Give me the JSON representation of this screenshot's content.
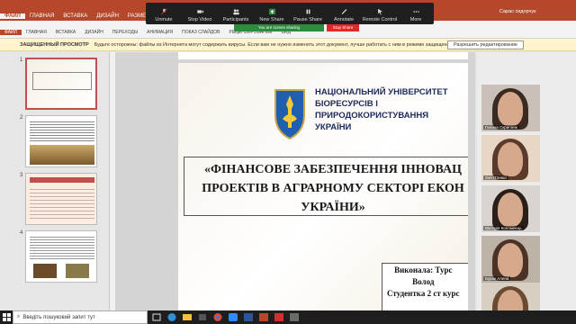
{
  "ribbon": {
    "tabs": [
      "ФАЙЛ",
      "ГЛАВНАЯ",
      "ВСТАВКА",
      "ДИЗАЙН",
      "РАЗМЕТКА СТРАН"
    ],
    "tabs2": [
      "ФАЙЛ",
      "ГЛАВНАЯ",
      "ВСТАВКА",
      "ДИЗАЙН",
      "ПЕРЕХОДЫ",
      "АНИМАЦИЯ",
      "ПОКАЗ СЛАЙДОВ",
      "РЕЦЕНЗИРОВАНИЕ",
      "ВИД"
    ],
    "user": "Сарас сидорчук"
  },
  "zoom": {
    "items": [
      {
        "label": "Unmute",
        "icon": "microphone-muted-icon"
      },
      {
        "label": "Stop Video",
        "icon": "video-camera-icon"
      },
      {
        "label": "Participants",
        "icon": "participants-icon",
        "count": "10"
      },
      {
        "label": "New Share",
        "icon": "share-screen-icon"
      },
      {
        "label": "Pause Share",
        "icon": "pause-icon"
      },
      {
        "label": "Annotate",
        "icon": "annotate-icon"
      },
      {
        "label": "Remote Control",
        "icon": "remote-control-icon"
      },
      {
        "label": "More",
        "icon": "more-icon"
      }
    ],
    "sharing_banner": "You are screen sharing",
    "stop_share": "Stop Share"
  },
  "protected_view": {
    "title": "ЗАЩИЩЕННЫЙ ПРОСМОТР",
    "message": "Будьте осторожны: файлы из Интернета могут содержать вирусы. Если вам не нужно изменять этот документ, лучше работать с ним в режиме защищенного просмотра.",
    "enable_button": "Разрешить редактирование"
  },
  "thumbnails": {
    "numbers": [
      "1",
      "2",
      "3",
      "4"
    ]
  },
  "slide": {
    "university": "НАЦІОНАЛЬНИЙ УНІВЕРСИТЕТ\nБІОРЕСУРСІВ І ПРИРОДОКОРИСТУВАННЯ\nУКРАЇНИ",
    "title": "«ФІНАНСОВЕ ЗАБЕЗПЕЧЕННЯ ІННОВАЦ\nПРОЕКТІВ В АГРАРНОМУ СЕКТОРІ ЕКОН\nУКРАЇНИ»",
    "author": "Виконала: Турс\nВолод\nСтудентка 2 ст курс"
  },
  "participants": [
    {
      "name": "Галина Скрипник",
      "hair": "#3a2a22",
      "bg": "#c9c0b8"
    },
    {
      "name": "Зоя Птенко",
      "hair": "#5a3a2a",
      "bg": "#e8d7c4"
    },
    {
      "name": "Вікторія Коломиєць",
      "hair": "#2a1e18",
      "bg": "#d9d4cf"
    },
    {
      "name": "Бурак Алена",
      "hair": "#4a3326",
      "bg": "#bcb2a6"
    },
    {
      "name": "",
      "hair": "#6b4a32",
      "bg": "#d8cfc3"
    }
  ],
  "taskbar": {
    "search_placeholder": "Введіть пошуковий запит тут"
  },
  "colors": {
    "accent": "#b7472a",
    "zoom_bar": "#1f1f1f",
    "share_green": "#2d8c3c",
    "stop_red": "#e02828"
  }
}
